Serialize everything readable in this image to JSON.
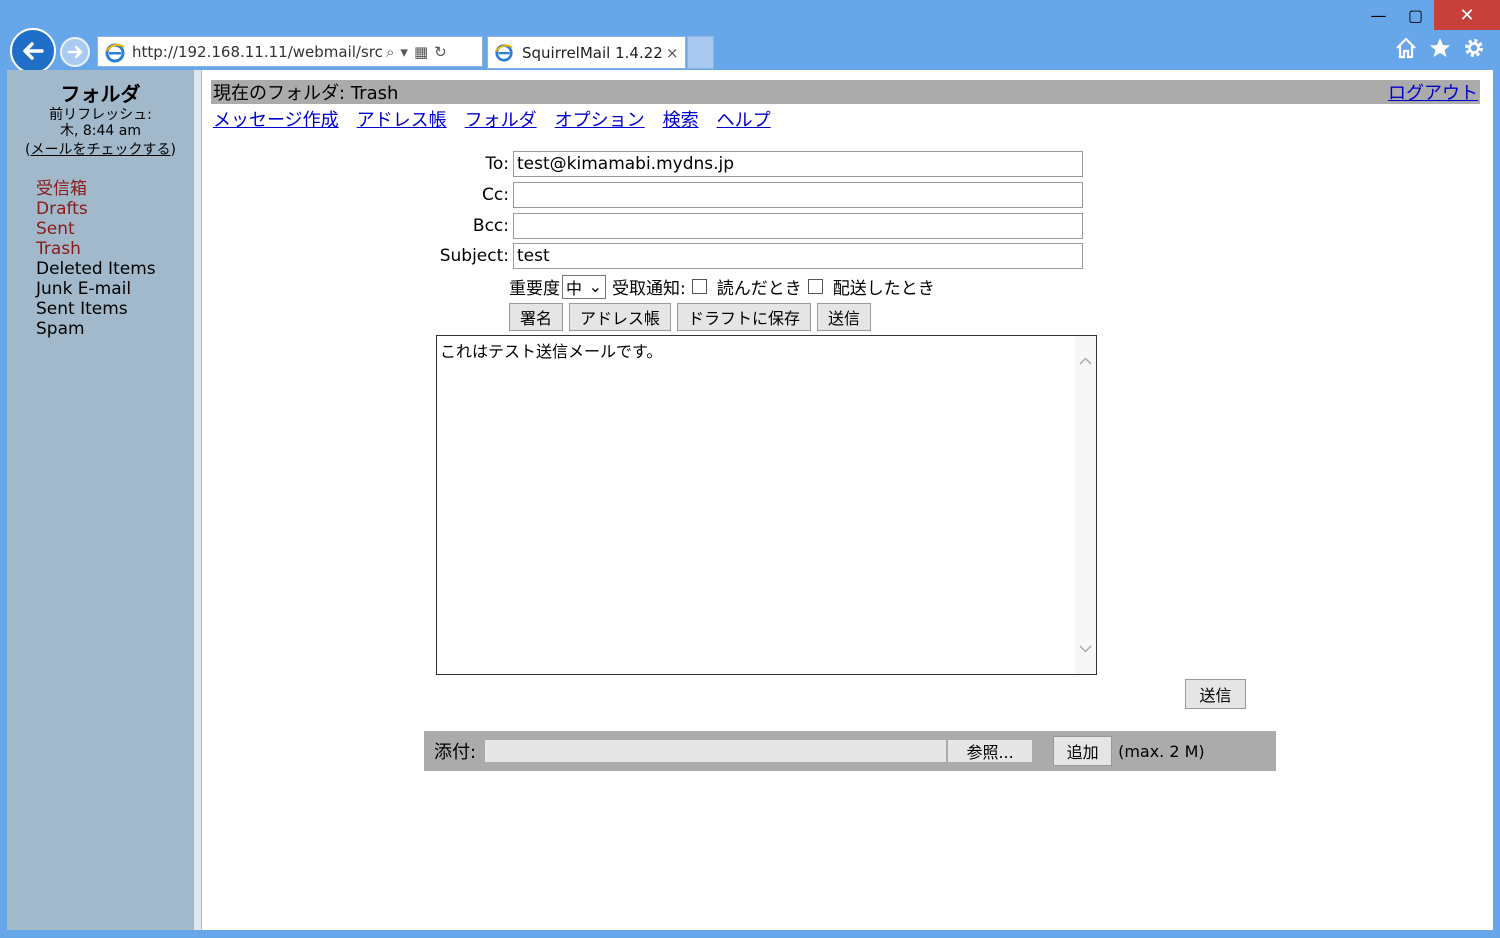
{
  "browser": {
    "url": "http://192.168.11.11/webmail/src",
    "tab_title": "SquirrelMail 1.4.22",
    "tab_close": "×",
    "win_min": "—",
    "win_max": "▢",
    "win_close": "✕"
  },
  "sidebar": {
    "heading": "フォルダ",
    "refresh_label": "前リフレッシュ:",
    "refresh_time": "木, 8:44 am",
    "check_mail": "メールをチェックする",
    "folders": [
      {
        "label": "受信箱",
        "color": "#8b1a1a"
      },
      {
        "label": "Drafts",
        "color": "#8b1a1a"
      },
      {
        "label": "Sent",
        "color": "#8b1a1a"
      },
      {
        "label": "Trash",
        "color": "#8b1a1a"
      },
      {
        "label": "Deleted Items",
        "color": "#000000"
      },
      {
        "label": "Junk E-mail",
        "color": "#000000"
      },
      {
        "label": "Sent Items",
        "color": "#000000"
      },
      {
        "label": "Spam",
        "color": "#000000"
      }
    ]
  },
  "header": {
    "current_folder_label": "現在のフォルダ:",
    "current_folder": "Trash",
    "logout": "ログアウト"
  },
  "menu": [
    "メッセージ作成",
    "アドレス帳",
    "フォルダ",
    "オプション",
    "検索",
    "ヘルプ"
  ],
  "compose": {
    "to_label": "To:",
    "to_value": "test@kimamabi.mydns.jp",
    "cc_label": "Cc:",
    "cc_value": "",
    "bcc_label": "Bcc:",
    "bcc_value": "",
    "subject_label": "Subject:",
    "subject_value": "test",
    "priority_label": "重要度",
    "priority_value": "中",
    "receipt_label": "受取通知:",
    "receipt_read": "読んだとき",
    "receipt_delivered": "配送したとき",
    "buttons": {
      "signature": "署名",
      "addresses": "アドレス帳",
      "save_draft": "ドラフトに保存",
      "send": "送信"
    },
    "body": "これはテスト送信メールです。",
    "send_bottom": "送信"
  },
  "attachment": {
    "label": "添付:",
    "browse": "参照...",
    "add": "追加",
    "max": "(max. 2 M)"
  }
}
